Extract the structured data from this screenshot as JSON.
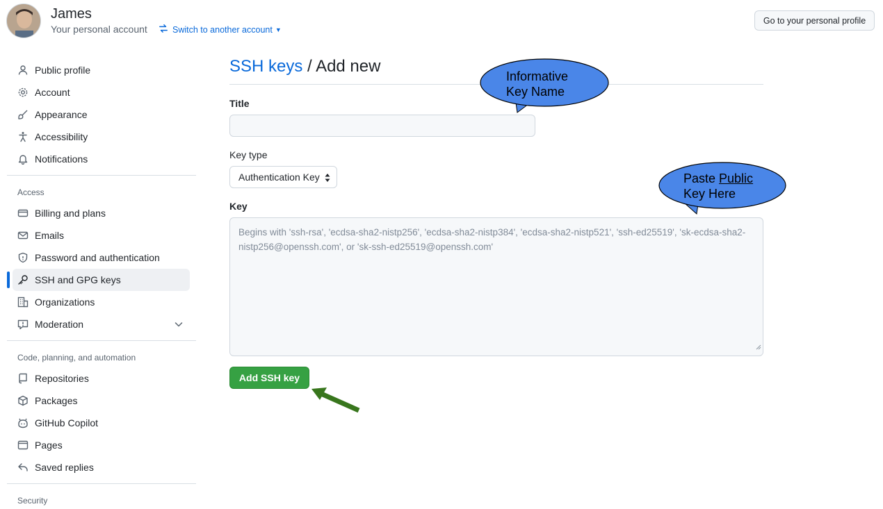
{
  "header": {
    "name": "James",
    "subtitle": "Your personal account",
    "switch_label": "Switch to another account",
    "profile_button": "Go to your personal profile"
  },
  "sidebar": {
    "items": [
      {
        "label": "Public profile",
        "icon": "person-icon"
      },
      {
        "label": "Account",
        "icon": "gear-icon"
      },
      {
        "label": "Appearance",
        "icon": "paintbrush-icon"
      },
      {
        "label": "Accessibility",
        "icon": "accessibility-icon"
      },
      {
        "label": "Notifications",
        "icon": "bell-icon"
      }
    ],
    "access_heading": "Access",
    "access_items": [
      {
        "label": "Billing and plans",
        "icon": "credit-card-icon"
      },
      {
        "label": "Emails",
        "icon": "mail-icon"
      },
      {
        "label": "Password and authentication",
        "icon": "shield-icon"
      },
      {
        "label": "SSH and GPG keys",
        "icon": "key-icon",
        "active": true
      },
      {
        "label": "Organizations",
        "icon": "organization-icon"
      },
      {
        "label": "Moderation",
        "icon": "report-icon"
      }
    ],
    "code_heading": "Code, planning, and automation",
    "code_items": [
      {
        "label": "Repositories",
        "icon": "repo-icon"
      },
      {
        "label": "Packages",
        "icon": "package-icon"
      },
      {
        "label": "GitHub Copilot",
        "icon": "copilot-icon"
      },
      {
        "label": "Pages",
        "icon": "browser-icon"
      },
      {
        "label": "Saved replies",
        "icon": "reply-icon"
      }
    ],
    "security_heading": "Security"
  },
  "main": {
    "breadcrumb_link": "SSH keys",
    "breadcrumb_sep": " / ",
    "page_title": "Add new",
    "title_label": "Title",
    "title_value": "",
    "key_type_label": "Key type",
    "key_type_value": "Authentication Key",
    "key_label": "Key",
    "key_placeholder": "Begins with 'ssh-rsa', 'ecdsa-sha2-nistp256', 'ecdsa-sha2-nistp384', 'ecdsa-sha2-nistp521', 'ssh-ed25519', 'sk-ecdsa-sha2-nistp256@openssh.com', or 'sk-ssh-ed25519@openssh.com'",
    "add_button": "Add SSH key"
  },
  "annotations": {
    "callout_title_line1": "Informative",
    "callout_title_line2": "Key Name",
    "callout_key_line1_prefix": "Paste ",
    "callout_key_line1_underlined": "Public",
    "callout_key_line2": "Key Here",
    "callout_color": "#4a86e8",
    "arrow_color": "#38761d"
  },
  "colors": {
    "link": "#0969da",
    "primary_button": "#36a143",
    "active_indicator": "#0969da"
  }
}
